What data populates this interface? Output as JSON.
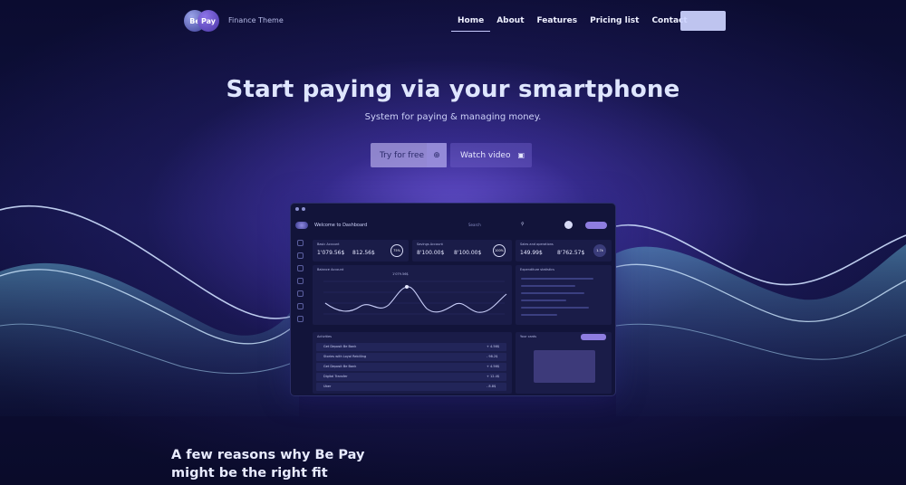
{
  "nav": {
    "logo_left": "Be",
    "logo_right": "Pay",
    "subtitle": "Finance Theme",
    "items": [
      {
        "label": "Home",
        "active": true
      },
      {
        "label": "About",
        "active": false
      },
      {
        "label": "Features",
        "active": false
      },
      {
        "label": "Pricing list",
        "active": false
      },
      {
        "label": "Contact",
        "active": false
      }
    ]
  },
  "hero": {
    "title": "Start paying via your smartphone",
    "subtitle": "System for paying & managing money.",
    "try_label": "Try for free",
    "watch_label": "Watch video",
    "try_icon": "arrow-circle-icon",
    "watch_icon": "video-icon"
  },
  "dashboard": {
    "welcome": "Welcome to Dashboard",
    "search": "Search",
    "cards": [
      {
        "label": "Basic Account",
        "value1": "1'079.56$",
        "value2": "812.56$",
        "percent": "75%"
      },
      {
        "label": "Savings Account",
        "value1": "8'100.00$",
        "value2": "8'100.00$",
        "percent": "100%"
      },
      {
        "label": "Sales and operations",
        "value1": "149.99$",
        "value2": "8'762.57$",
        "percent": "1.7k"
      }
    ],
    "balance_title": "Balance Account",
    "peak_label": "1'079.56$",
    "expenditure_title": "Expenditure statistics",
    "activities_title": "Activities",
    "activities": [
      {
        "name": "Get Deposit Be Bank",
        "amount": "+ 4.56$"
      },
      {
        "name": "Stories with Loyal Rebilling",
        "amount": "- 98.2$"
      },
      {
        "name": "Get Deposit Be Bank",
        "amount": "+ 4.56$"
      },
      {
        "name": "Digital Transfer",
        "amount": "+ 12.4$"
      },
      {
        "name": "Uber",
        "amount": "- 8.8$"
      }
    ],
    "cards_title": "Your cards"
  },
  "reasons": {
    "line1": "A few reasons why Be Pay",
    "line2": "might be the right fit"
  },
  "colors": {
    "accent": "#8e7de0",
    "background": "#0a0b2c",
    "glow": "#7660e6"
  }
}
